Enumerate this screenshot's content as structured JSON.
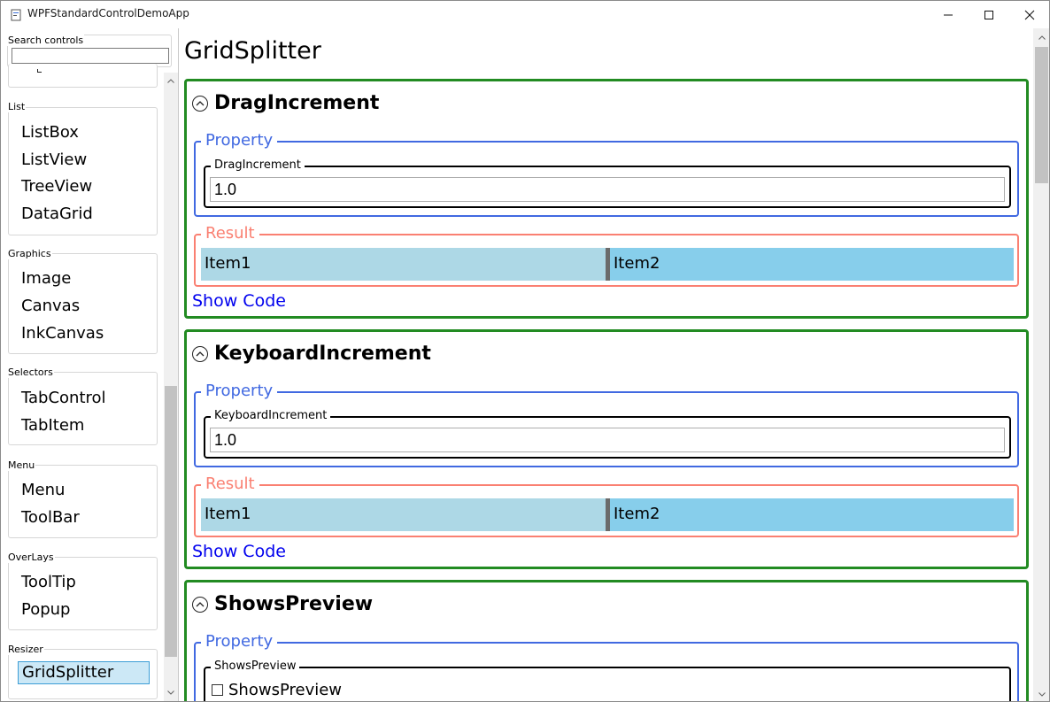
{
  "window": {
    "title": "WPFStandardControlDemoApp"
  },
  "sidebar": {
    "search_label": "Search controls",
    "search_value": "",
    "groups": [
      {
        "label": "List",
        "items": [
          "ListBox",
          "ListView",
          "TreeView",
          "DataGrid"
        ]
      },
      {
        "label": "Graphics",
        "items": [
          "Image",
          "Canvas",
          "InkCanvas"
        ]
      },
      {
        "label": "Selectors",
        "items": [
          "TabControl",
          "TabItem"
        ]
      },
      {
        "label": "Menu",
        "items": [
          "Menu",
          "ToolBar"
        ]
      },
      {
        "label": "OverLays",
        "items": [
          "ToolTip",
          "Popup"
        ]
      },
      {
        "label": "Resizer",
        "items": [
          "GridSplitter"
        ]
      }
    ],
    "selected_item": "GridSplitter"
  },
  "main": {
    "page_title": "GridSplitter",
    "sections": [
      {
        "title": "DragIncrement",
        "property_label": "Property",
        "field_label": "DragIncrement",
        "field_value": "1.0",
        "result_label": "Result",
        "item1": "Item1",
        "item2": "Item2",
        "show_code": "Show Code"
      },
      {
        "title": "KeyboardIncrement",
        "property_label": "Property",
        "field_label": "KeyboardIncrement",
        "field_value": "1.0",
        "result_label": "Result",
        "item1": "Item1",
        "item2": "Item2",
        "show_code": "Show Code"
      },
      {
        "title": "ShowsPreview",
        "property_label": "Property",
        "field_label": "ShowsPreview",
        "checkbox_label": "ShowsPreview",
        "checkbox_checked": false
      }
    ]
  },
  "colors": {
    "section_border": "#228b22",
    "property_border": "#4169e1",
    "result_border": "#fa8072",
    "item1_bg": "#add8e6",
    "item2_bg": "#87ceeb",
    "link": "#0000ee",
    "selection_bg": "#cce8f6"
  }
}
